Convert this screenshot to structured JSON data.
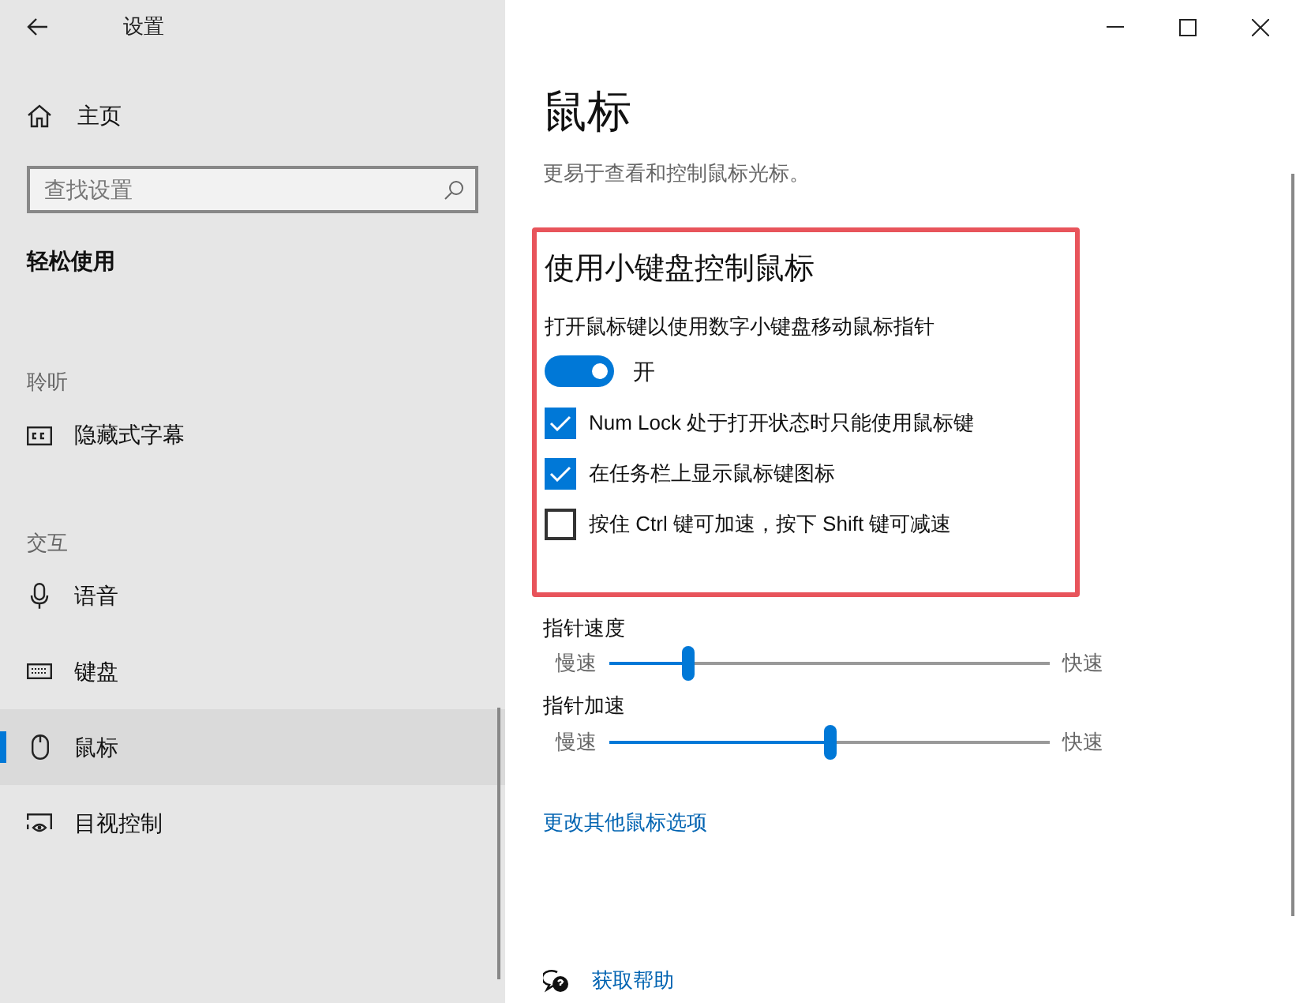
{
  "window": {
    "title": "设置"
  },
  "sidebar": {
    "home": "主页",
    "search": {
      "placeholder": "查找设置"
    },
    "section_title": "轻松使用",
    "groups": [
      {
        "title": "聆听",
        "items": [
          {
            "label": "隐藏式字幕",
            "selected": false
          }
        ]
      },
      {
        "title": "交互",
        "items": [
          {
            "label": "语音",
            "selected": false
          },
          {
            "label": "键盘",
            "selected": false
          },
          {
            "label": "鼠标",
            "selected": true
          },
          {
            "label": "目视控制",
            "selected": false
          }
        ]
      }
    ]
  },
  "page": {
    "title": "鼠标",
    "description": "更易于查看和控制鼠标光标。",
    "section": {
      "title": "使用小键盘控制鼠标",
      "toggle_label": "打开鼠标键以使用数字小键盘移动鼠标指针",
      "toggle": {
        "on": true,
        "state_text": "开"
      },
      "checkboxes": [
        {
          "label": "Num Lock 处于打开状态时只能使用鼠标键",
          "checked": true
        },
        {
          "label": "在任务栏上显示鼠标键图标",
          "checked": true
        },
        {
          "label": "按住 Ctrl 键可加速，按下 Shift 键可减速",
          "checked": false
        }
      ]
    },
    "sliders": [
      {
        "label": "指针速度",
        "min_label": "慢速",
        "max_label": "快速",
        "level": 0.18
      },
      {
        "label": "指针加速",
        "min_label": "慢速",
        "max_label": "快速",
        "level": 0.5
      }
    ],
    "link": "更改其他鼠标选项",
    "help": "获取帮助"
  }
}
